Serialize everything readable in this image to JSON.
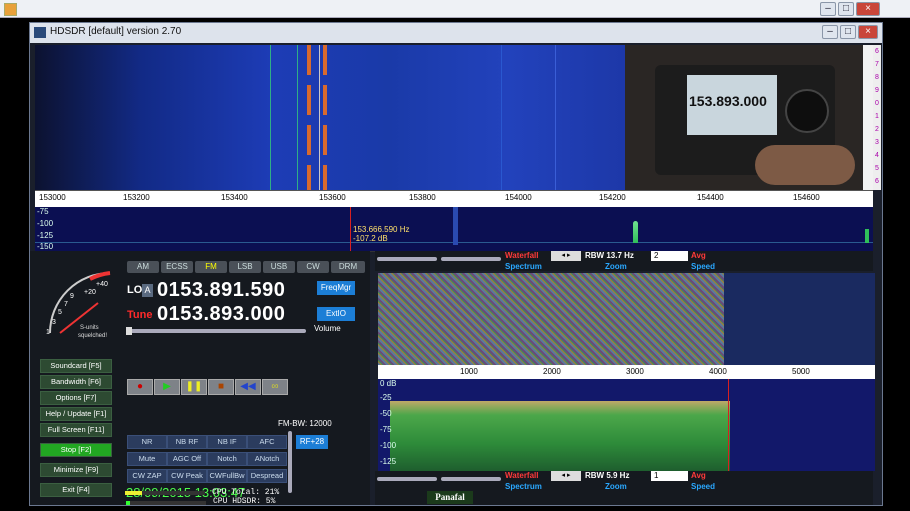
{
  "window": {
    "title": "HDSDR [default]  version 2.70"
  },
  "waterfall": {
    "scale": [
      "153000",
      "153200",
      "153400",
      "153600",
      "153800",
      "154000",
      "154200",
      "154400",
      "154600"
    ],
    "right_scale": [
      "6",
      "7",
      "8",
      "9",
      "0",
      "1",
      "2",
      "3",
      "4",
      "5",
      "6"
    ],
    "camera_display": "153.893.000"
  },
  "spectrum": {
    "db_labels": [
      "-75",
      "-100",
      "-125",
      "-150"
    ],
    "marker_freq": "153.666.590 Hz",
    "marker_db": "-107.2 dB"
  },
  "modes": [
    "AM",
    "ECSS",
    "FM",
    "LSB",
    "USB",
    "CW",
    "DRM"
  ],
  "smeter": {
    "ticks": [
      "+40",
      "+20",
      "9",
      "7",
      "5",
      "3",
      "1"
    ],
    "text1": "S-units",
    "text2": "squelched!"
  },
  "lo": {
    "label": "LO",
    "badge": "A",
    "value": "0153.891.590"
  },
  "tune": {
    "label": "Tune",
    "value": "0153.893.000"
  },
  "freqmgr_label": "FreqMgr",
  "extio_label": "ExtIO",
  "volume_label": "Volume",
  "side_buttons": [
    "Soundcard  [F5]",
    "Bandwidth  [F6]",
    "Options  [F7]",
    "Help / Update  [F1]",
    "Full Screen  [F11]",
    "Stop  [F2]",
    "Minimize  [F9]",
    "Exit  [F4]"
  ],
  "fm_bw_label": "FM-BW: 12000",
  "rf_label": "RF+28",
  "dsp_buttons": [
    "NR",
    "NB RF",
    "NB IF",
    "AFC",
    "Mute",
    "AGC Off",
    "Notch",
    "ANotch",
    "CW ZAP",
    "CW Peak",
    "CWFullBw",
    "Despread"
  ],
  "datetime": "28/09/2015 13:03:47",
  "cpu": {
    "hdsdr": "CPU HDSDR:  5%",
    "total": "CPU Total: 21%"
  },
  "rtool_top": {
    "waterfall": "Waterfall",
    "rbw": "RBW 13.7 Hz",
    "avg_value": "2",
    "avg": "Avg",
    "spectrum": "Spectrum",
    "zoom": "Zoom",
    "speed": "Speed"
  },
  "rtool_bottom": {
    "waterfall": "Waterfall",
    "rbw": "RBW  5.9 Hz",
    "avg_value": "1",
    "avg": "Avg",
    "spectrum": "Spectrum",
    "zoom": "Zoom",
    "speed": "Speed"
  },
  "af_scale": [
    "1000",
    "2000",
    "3000",
    "4000",
    "5000"
  ],
  "af_db": [
    "0 dB",
    "-25",
    "-50",
    "-75",
    "-100",
    "-125"
  ],
  "panafal": "Panafal",
  "colors": {
    "waterfall_red": "#ff2a2a",
    "lo_blue": "#0a8cff",
    "tune_red": "#ff2a2a",
    "date_green": "#4cff4c",
    "stop_green": "#22a722"
  }
}
